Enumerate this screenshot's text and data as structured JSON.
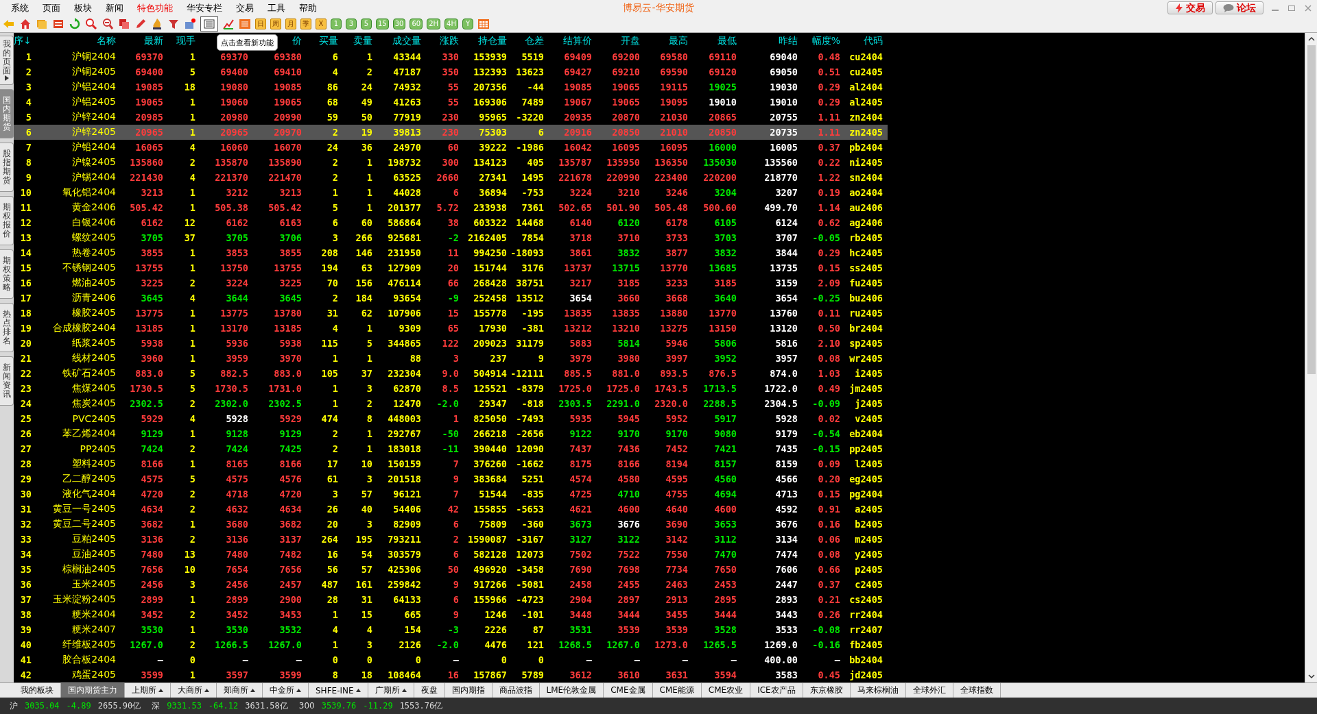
{
  "menu": [
    {
      "label": "系统",
      "highlighted": false
    },
    {
      "label": "页面",
      "highlighted": false
    },
    {
      "label": "板块",
      "highlighted": false
    },
    {
      "label": "新闻",
      "highlighted": false
    },
    {
      "label": "特色功能",
      "highlighted": true
    },
    {
      "label": "华安专栏",
      "highlighted": false
    },
    {
      "label": "交易",
      "highlighted": false
    },
    {
      "label": "工具",
      "highlighted": false
    },
    {
      "label": "帮助",
      "highlighted": false
    }
  ],
  "title": "博易云-华安期货",
  "top_buttons": [
    {
      "label": "交易",
      "kind": "trade"
    },
    {
      "label": "论坛",
      "kind": "forum"
    }
  ],
  "periods": [
    "日",
    "周",
    "月",
    "季",
    "X",
    "1",
    "3",
    "5",
    "15",
    "30",
    "60",
    "2H",
    "4H",
    "Y"
  ],
  "tooltip": "点击查看新功能",
  "side_tabs": [
    {
      "label": "我的页面",
      "selected": false,
      "menu": true
    },
    {
      "label": "国内期货",
      "selected": true,
      "menu": false
    },
    {
      "label": "股指期货",
      "selected": false,
      "menu": false
    },
    {
      "label": "期权报价",
      "selected": false,
      "menu": false
    },
    {
      "label": "期权策略",
      "selected": false,
      "menu": false
    },
    {
      "label": "热点排名",
      "selected": false,
      "menu": false
    },
    {
      "label": "新闻资讯",
      "selected": false,
      "menu": false
    }
  ],
  "table": {
    "columns": [
      {
        "label": "序↓",
        "kind": "index"
      },
      {
        "label": "名称",
        "kind": "name"
      },
      {
        "label": "最新",
        "kind": "price"
      },
      {
        "label": "现手",
        "kind": "volume"
      },
      {
        "kind": "price"
      },
      {
        "label": "价",
        "kind": "price"
      },
      {
        "label": "买量",
        "kind": "volume"
      },
      {
        "label": "卖量",
        "kind": "volume"
      },
      {
        "label": "成交量",
        "kind": "volume"
      },
      {
        "label": "涨跌",
        "kind": "change"
      },
      {
        "label": "持仓量",
        "kind": "volume"
      },
      {
        "label": "仓差",
        "kind": "volume"
      },
      {
        "label": "结算价",
        "kind": "price"
      },
      {
        "label": "开盘",
        "kind": "price"
      },
      {
        "label": "最高",
        "kind": "price"
      },
      {
        "label": "最低",
        "kind": "price"
      },
      {
        "label": "昨结",
        "kind": "prev"
      },
      {
        "label": "幅度%",
        "kind": "change"
      },
      {
        "label": "代码",
        "kind": "code"
      }
    ],
    "rows": [
      {
        "selected": false,
        "cells": [
          "1",
          "沪铜2404",
          "69370",
          "1",
          "69370",
          "69380",
          "6",
          "1",
          "43344",
          "330",
          "153939",
          "5519",
          "69409",
          "69200",
          "69580",
          "69110",
          "69040",
          "0.48",
          "cu2404"
        ]
      },
      {
        "selected": false,
        "cells": [
          "2",
          "沪铜2405",
          "69400",
          "5",
          "69400",
          "69410",
          "4",
          "2",
          "47187",
          "350",
          "132393",
          "13623",
          "69427",
          "69210",
          "69590",
          "69120",
          "69050",
          "0.51",
          "cu2405"
        ]
      },
      {
        "selected": false,
        "cells": [
          "3",
          "沪铝2404",
          "19085",
          "18",
          "19080",
          "19085",
          "86",
          "24",
          "74932",
          "55",
          "207356",
          "-44",
          "19085",
          "19065",
          "19115",
          "19025",
          "19030",
          "0.29",
          "al2404"
        ]
      },
      {
        "selected": false,
        "cells": [
          "4",
          "沪铝2405",
          "19065",
          "1",
          "19060",
          "19065",
          "68",
          "49",
          "41263",
          "55",
          "169306",
          "7489",
          "19067",
          "19065",
          "19095",
          "19010",
          "19010",
          "0.29",
          "al2405"
        ]
      },
      {
        "selected": false,
        "cells": [
          "5",
          "沪锌2404",
          "20985",
          "1",
          "20980",
          "20990",
          "59",
          "50",
          "77919",
          "230",
          "95965",
          "-3220",
          "20935",
          "20870",
          "21030",
          "20865",
          "20755",
          "1.11",
          "zn2404"
        ]
      },
      {
        "selected": true,
        "cells": [
          "6",
          "沪锌2405",
          "20965",
          "1",
          "20965",
          "20970",
          "2",
          "19",
          "39813",
          "230",
          "75303",
          "6",
          "20916",
          "20850",
          "21010",
          "20850",
          "20735",
          "1.11",
          "zn2405"
        ]
      },
      {
        "selected": false,
        "cells": [
          "7",
          "沪铅2404",
          "16065",
          "4",
          "16060",
          "16070",
          "24",
          "36",
          "24970",
          "60",
          "39222",
          "-1986",
          "16042",
          "16095",
          "16095",
          "16000",
          "16005",
          "0.37",
          "pb2404"
        ]
      },
      {
        "selected": false,
        "cells": [
          "8",
          "沪镍2405",
          "135860",
          "2",
          "135870",
          "135890",
          "2",
          "1",
          "198732",
          "300",
          "134123",
          "405",
          "135787",
          "135950",
          "136350",
          "135030",
          "135560",
          "0.22",
          "ni2405"
        ]
      },
      {
        "selected": false,
        "cells": [
          "9",
          "沪锡2404",
          "221430",
          "4",
          "221370",
          "221470",
          "2",
          "1",
          "63525",
          "2660",
          "27341",
          "1495",
          "221678",
          "220990",
          "223400",
          "220200",
          "218770",
          "1.22",
          "sn2404"
        ]
      },
      {
        "selected": false,
        "cells": [
          "10",
          "氧化铝2404",
          "3213",
          "1",
          "3212",
          "3213",
          "1",
          "1",
          "44028",
          "6",
          "36894",
          "-753",
          "3224",
          "3210",
          "3246",
          "3204",
          "3207",
          "0.19",
          "ao2404"
        ]
      },
      {
        "selected": false,
        "cells": [
          "11",
          "黄金2406",
          "505.42",
          "1",
          "505.38",
          "505.42",
          "5",
          "1",
          "201377",
          "5.72",
          "233938",
          "7361",
          "502.65",
          "501.90",
          "505.48",
          "500.60",
          "499.70",
          "1.14",
          "au2406"
        ]
      },
      {
        "selected": false,
        "cells": [
          "12",
          "白银2406",
          "6162",
          "12",
          "6162",
          "6163",
          "6",
          "60",
          "586864",
          "38",
          "603322",
          "14468",
          "6140",
          "6120",
          "6178",
          "6105",
          "6124",
          "0.62",
          "ag2406"
        ]
      },
      {
        "selected": false,
        "cells": [
          "13",
          "螺纹2405",
          "3705",
          "37",
          "3705",
          "3706",
          "3",
          "266",
          "925681",
          "-2",
          "2162405",
          "7854",
          "3718",
          "3710",
          "3733",
          "3703",
          "3707",
          "-0.05",
          "rb2405"
        ]
      },
      {
        "selected": false,
        "cells": [
          "14",
          "热卷2405",
          "3855",
          "1",
          "3853",
          "3855",
          "208",
          "146",
          "231950",
          "11",
          "994250",
          "-18093",
          "3861",
          "3832",
          "3877",
          "3832",
          "3844",
          "0.29",
          "hc2405"
        ]
      },
      {
        "selected": false,
        "cells": [
          "15",
          "不锈钢2405",
          "13755",
          "1",
          "13750",
          "13755",
          "194",
          "63",
          "127909",
          "20",
          "151744",
          "3176",
          "13737",
          "13715",
          "13770",
          "13685",
          "13735",
          "0.15",
          "ss2405"
        ]
      },
      {
        "selected": false,
        "cells": [
          "16",
          "燃油2405",
          "3225",
          "2",
          "3224",
          "3225",
          "70",
          "156",
          "476114",
          "66",
          "268428",
          "38751",
          "3217",
          "3185",
          "3233",
          "3185",
          "3159",
          "2.09",
          "fu2405"
        ]
      },
      {
        "selected": false,
        "cells": [
          "17",
          "沥青2406",
          "3645",
          "4",
          "3644",
          "3645",
          "2",
          "184",
          "93654",
          "-9",
          "252458",
          "13512",
          "3654",
          "3660",
          "3668",
          "3640",
          "3654",
          "-0.25",
          "bu2406"
        ]
      },
      {
        "selected": false,
        "cells": [
          "18",
          "橡胶2405",
          "13775",
          "1",
          "13775",
          "13780",
          "31",
          "62",
          "107906",
          "15",
          "155778",
          "-195",
          "13835",
          "13835",
          "13880",
          "13770",
          "13760",
          "0.11",
          "ru2405"
        ]
      },
      {
        "selected": false,
        "cells": [
          "19",
          "合成橡胶2404",
          "13185",
          "1",
          "13170",
          "13185",
          "4",
          "1",
          "9309",
          "65",
          "17930",
          "-381",
          "13212",
          "13210",
          "13275",
          "13150",
          "13120",
          "0.50",
          "br2404"
        ]
      },
      {
        "selected": false,
        "cells": [
          "20",
          "纸浆2405",
          "5938",
          "1",
          "5936",
          "5938",
          "115",
          "5",
          "344865",
          "122",
          "209023",
          "31179",
          "5883",
          "5814",
          "5946",
          "5806",
          "5816",
          "2.10",
          "sp2405"
        ]
      },
      {
        "selected": false,
        "cells": [
          "21",
          "线材2405",
          "3960",
          "1",
          "3959",
          "3970",
          "1",
          "1",
          "88",
          "3",
          "237",
          "9",
          "3979",
          "3980",
          "3997",
          "3952",
          "3957",
          "0.08",
          "wr2405"
        ]
      },
      {
        "selected": false,
        "cells": [
          "22",
          "铁矿石2405",
          "883.0",
          "5",
          "882.5",
          "883.0",
          "105",
          "37",
          "232304",
          "9.0",
          "504914",
          "-12111",
          "885.5",
          "881.0",
          "893.5",
          "876.5",
          "874.0",
          "1.03",
          "i2405"
        ]
      },
      {
        "selected": false,
        "cells": [
          "23",
          "焦煤2405",
          "1730.5",
          "5",
          "1730.5",
          "1731.0",
          "1",
          "3",
          "62870",
          "8.5",
          "125521",
          "-8379",
          "1725.0",
          "1725.0",
          "1743.5",
          "1713.5",
          "1722.0",
          "0.49",
          "jm2405"
        ]
      },
      {
        "selected": false,
        "cells": [
          "24",
          "焦炭2405",
          "2302.5",
          "2",
          "2302.0",
          "2302.5",
          "1",
          "2",
          "12470",
          "-2.0",
          "29347",
          "-818",
          "2303.5",
          "2291.0",
          "2320.0",
          "2288.5",
          "2304.5",
          "-0.09",
          "j2405"
        ]
      },
      {
        "selected": false,
        "cells": [
          "25",
          "PVC2405",
          "5929",
          "4",
          "5928",
          "5929",
          "474",
          "8",
          "448003",
          "1",
          "825050",
          "-7493",
          "5935",
          "5945",
          "5952",
          "5917",
          "5928",
          "0.02",
          "v2405"
        ]
      },
      {
        "selected": false,
        "cells": [
          "26",
          "苯乙烯2404",
          "9129",
          "1",
          "9128",
          "9129",
          "2",
          "1",
          "292767",
          "-50",
          "266218",
          "-2656",
          "9122",
          "9170",
          "9170",
          "9080",
          "9179",
          "-0.54",
          "eb2404"
        ]
      },
      {
        "selected": false,
        "cells": [
          "27",
          "PP2405",
          "7424",
          "2",
          "7424",
          "7425",
          "2",
          "1",
          "183018",
          "-11",
          "390440",
          "12090",
          "7437",
          "7436",
          "7452",
          "7421",
          "7435",
          "-0.15",
          "pp2405"
        ]
      },
      {
        "selected": false,
        "cells": [
          "28",
          "塑料2405",
          "8166",
          "1",
          "8165",
          "8166",
          "17",
          "10",
          "150159",
          "7",
          "376260",
          "-1662",
          "8175",
          "8166",
          "8194",
          "8157",
          "8159",
          "0.09",
          "l2405"
        ]
      },
      {
        "selected": false,
        "cells": [
          "29",
          "乙二醇2405",
          "4575",
          "5",
          "4575",
          "4576",
          "61",
          "3",
          "201518",
          "9",
          "383684",
          "5251",
          "4574",
          "4580",
          "4595",
          "4560",
          "4566",
          "0.20",
          "eg2405"
        ]
      },
      {
        "selected": false,
        "cells": [
          "30",
          "液化气2404",
          "4720",
          "2",
          "4718",
          "4720",
          "3",
          "57",
          "96121",
          "7",
          "51544",
          "-835",
          "4725",
          "4710",
          "4755",
          "4694",
          "4713",
          "0.15",
          "pg2404"
        ]
      },
      {
        "selected": false,
        "cells": [
          "31",
          "黄豆一号2405",
          "4634",
          "2",
          "4632",
          "4634",
          "26",
          "40",
          "54406",
          "42",
          "155855",
          "-5653",
          "4621",
          "4600",
          "4640",
          "4600",
          "4592",
          "0.91",
          "a2405"
        ]
      },
      {
        "selected": false,
        "cells": [
          "32",
          "黄豆二号2405",
          "3682",
          "1",
          "3680",
          "3682",
          "20",
          "3",
          "82909",
          "6",
          "75809",
          "-360",
          "3673",
          "3676",
          "3690",
          "3653",
          "3676",
          "0.16",
          "b2405"
        ]
      },
      {
        "selected": false,
        "cells": [
          "33",
          "豆粕2405",
          "3136",
          "2",
          "3136",
          "3137",
          "264",
          "195",
          "793211",
          "2",
          "1590087",
          "-3167",
          "3127",
          "3122",
          "3142",
          "3112",
          "3134",
          "0.06",
          "m2405"
        ]
      },
      {
        "selected": false,
        "cells": [
          "34",
          "豆油2405",
          "7480",
          "13",
          "7480",
          "7482",
          "16",
          "54",
          "303579",
          "6",
          "582128",
          "12073",
          "7502",
          "7522",
          "7550",
          "7470",
          "7474",
          "0.08",
          "y2405"
        ]
      },
      {
        "selected": false,
        "cells": [
          "35",
          "棕榈油2405",
          "7656",
          "10",
          "7654",
          "7656",
          "56",
          "57",
          "425306",
          "50",
          "496920",
          "-3458",
          "7690",
          "7698",
          "7734",
          "7650",
          "7606",
          "0.66",
          "p2405"
        ]
      },
      {
        "selected": false,
        "cells": [
          "36",
          "玉米2405",
          "2456",
          "3",
          "2456",
          "2457",
          "487",
          "161",
          "259842",
          "9",
          "917266",
          "-5081",
          "2458",
          "2455",
          "2463",
          "2453",
          "2447",
          "0.37",
          "c2405"
        ]
      },
      {
        "selected": false,
        "cells": [
          "37",
          "玉米淀粉2405",
          "2899",
          "1",
          "2899",
          "2900",
          "28",
          "31",
          "64133",
          "6",
          "155966",
          "-4723",
          "2904",
          "2897",
          "2913",
          "2895",
          "2893",
          "0.21",
          "cs2405"
        ]
      },
      {
        "selected": false,
        "cells": [
          "38",
          "粳米2404",
          "3452",
          "2",
          "3452",
          "3453",
          "1",
          "15",
          "665",
          "9",
          "1246",
          "-101",
          "3448",
          "3444",
          "3455",
          "3444",
          "3443",
          "0.26",
          "rr2404"
        ]
      },
      {
        "selected": false,
        "cells": [
          "39",
          "粳米2407",
          "3530",
          "1",
          "3530",
          "3532",
          "4",
          "4",
          "154",
          "-3",
          "2226",
          "87",
          "3531",
          "3539",
          "3539",
          "3528",
          "3533",
          "-0.08",
          "rr2407"
        ]
      },
      {
        "selected": false,
        "cells": [
          "40",
          "纤维板2405",
          "1267.0",
          "2",
          "1266.5",
          "1267.0",
          "1",
          "3",
          "2126",
          "-2.0",
          "4476",
          "121",
          "1268.5",
          "1267.0",
          "1273.0",
          "1265.5",
          "1269.0",
          "-0.16",
          "fb2405"
        ]
      },
      {
        "selected": false,
        "cells": [
          "41",
          "胶合板2404",
          "—",
          "0",
          "—",
          "—",
          "0",
          "0",
          "0",
          "—",
          "0",
          "0",
          "—",
          "—",
          "—",
          "—",
          "400.00",
          "—",
          "bb2404"
        ]
      },
      {
        "selected": false,
        "cells": [
          "42",
          "鸡蛋2405",
          "3599",
          "1",
          "3597",
          "3599",
          "8",
          "18",
          "108464",
          "16",
          "157867",
          "5789",
          "3612",
          "3610",
          "3631",
          "3594",
          "3583",
          "0.45",
          "jd2405"
        ]
      }
    ]
  },
  "bottom_tabs": [
    {
      "label": "我的板块",
      "selected": false,
      "menu": false
    },
    {
      "label": "国内期货主力",
      "selected": true,
      "menu": false
    },
    {
      "label": "上期所",
      "selected": false,
      "menu": true
    },
    {
      "label": "大商所",
      "selected": false,
      "menu": true
    },
    {
      "label": "郑商所",
      "selected": false,
      "menu": true
    },
    {
      "label": "中金所",
      "selected": false,
      "menu": true
    },
    {
      "label": "SHFE-INE",
      "selected": false,
      "menu": true
    },
    {
      "label": "广期所",
      "selected": false,
      "menu": true
    },
    {
      "label": "夜盘",
      "selected": false,
      "menu": false
    },
    {
      "label": "国内期指",
      "selected": false,
      "menu": false
    },
    {
      "label": "商品波指",
      "selected": false,
      "menu": false
    },
    {
      "label": "LME伦敦金属",
      "selected": false,
      "menu": false
    },
    {
      "label": "CME金属",
      "selected": false,
      "menu": false
    },
    {
      "label": "CME能源",
      "selected": false,
      "menu": false
    },
    {
      "label": "CME农业",
      "selected": false,
      "menu": false
    },
    {
      "label": "ICE农产品",
      "selected": false,
      "menu": false
    },
    {
      "label": "东京橡胶",
      "selected": false,
      "menu": false
    },
    {
      "label": "马来棕榈油",
      "selected": false,
      "menu": false
    },
    {
      "label": "全球外汇",
      "selected": false,
      "menu": false
    },
    {
      "label": "全球指数",
      "selected": false,
      "menu": false
    }
  ],
  "status_bar": [
    {
      "label": "沪",
      "value": "3035.04",
      "change": "-4.89",
      "amount": "2655.90亿"
    },
    {
      "label": "深",
      "value": "9331.53",
      "change": "-64.12",
      "amount": "3631.58亿"
    },
    {
      "label": "300",
      "value": "3539.76",
      "change": "-11.29",
      "amount": "1553.76亿"
    }
  ]
}
